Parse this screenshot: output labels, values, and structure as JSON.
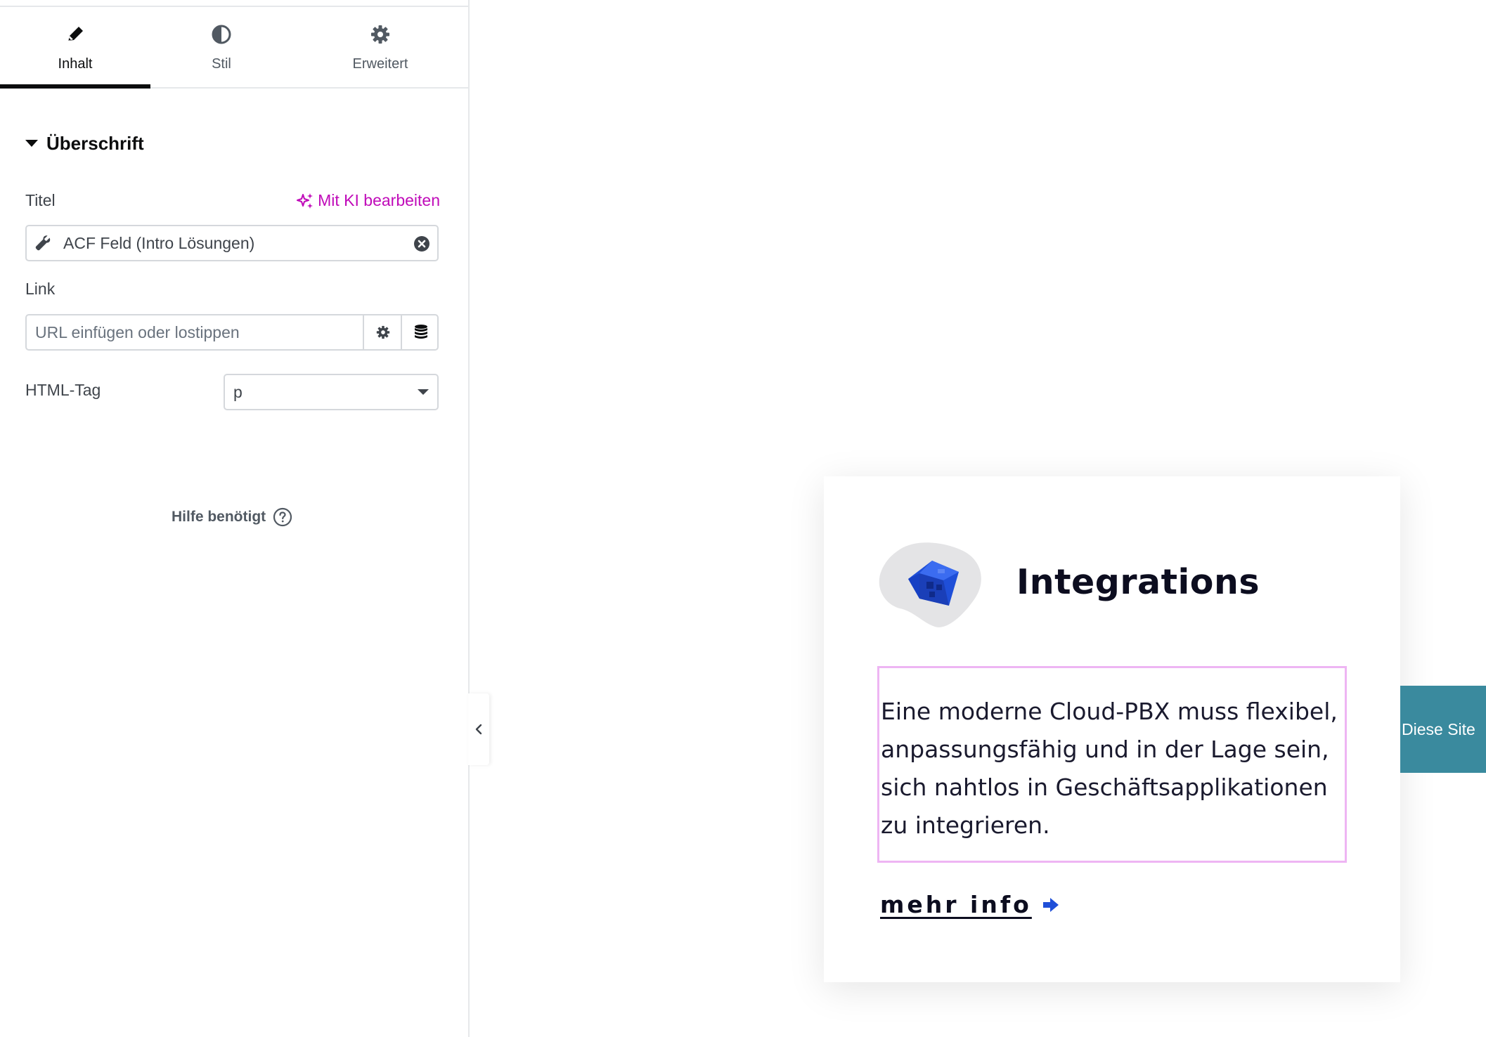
{
  "editor": {
    "tabs": [
      {
        "label": "Inhalt",
        "icon": "pencil-icon",
        "active": true
      },
      {
        "label": "Stil",
        "icon": "contrast-icon",
        "active": false
      },
      {
        "label": "Erweitert",
        "icon": "gear-icon",
        "active": false
      }
    ],
    "section_title": "Überschrift",
    "title_label": "Titel",
    "ai_edit_label": "Mit KI bearbeiten",
    "title_value": "ACF Feld (Intro Lösungen)",
    "link_label": "Link",
    "link_placeholder": "URL einfügen oder lostippen",
    "html_tag_label": "HTML-Tag",
    "html_tag_value": "p",
    "help_label": "Hilfe benötigt"
  },
  "preview": {
    "card_title": "Integrations",
    "card_text": "Eine moderne Cloud-PBX muss flexibel, anpassungsfähig und in der Lage sein, sich nahtlos in Geschäftsapplikationen zu integrieren.",
    "more_link": "mehr info",
    "side_tab": "Diese Site"
  },
  "colors": {
    "ai_accent": "#c00bb9",
    "selection_outline": "#eeb5f3",
    "side_tab_bg": "#3a8a9e",
    "icon_blue": "#1f4fd8"
  }
}
